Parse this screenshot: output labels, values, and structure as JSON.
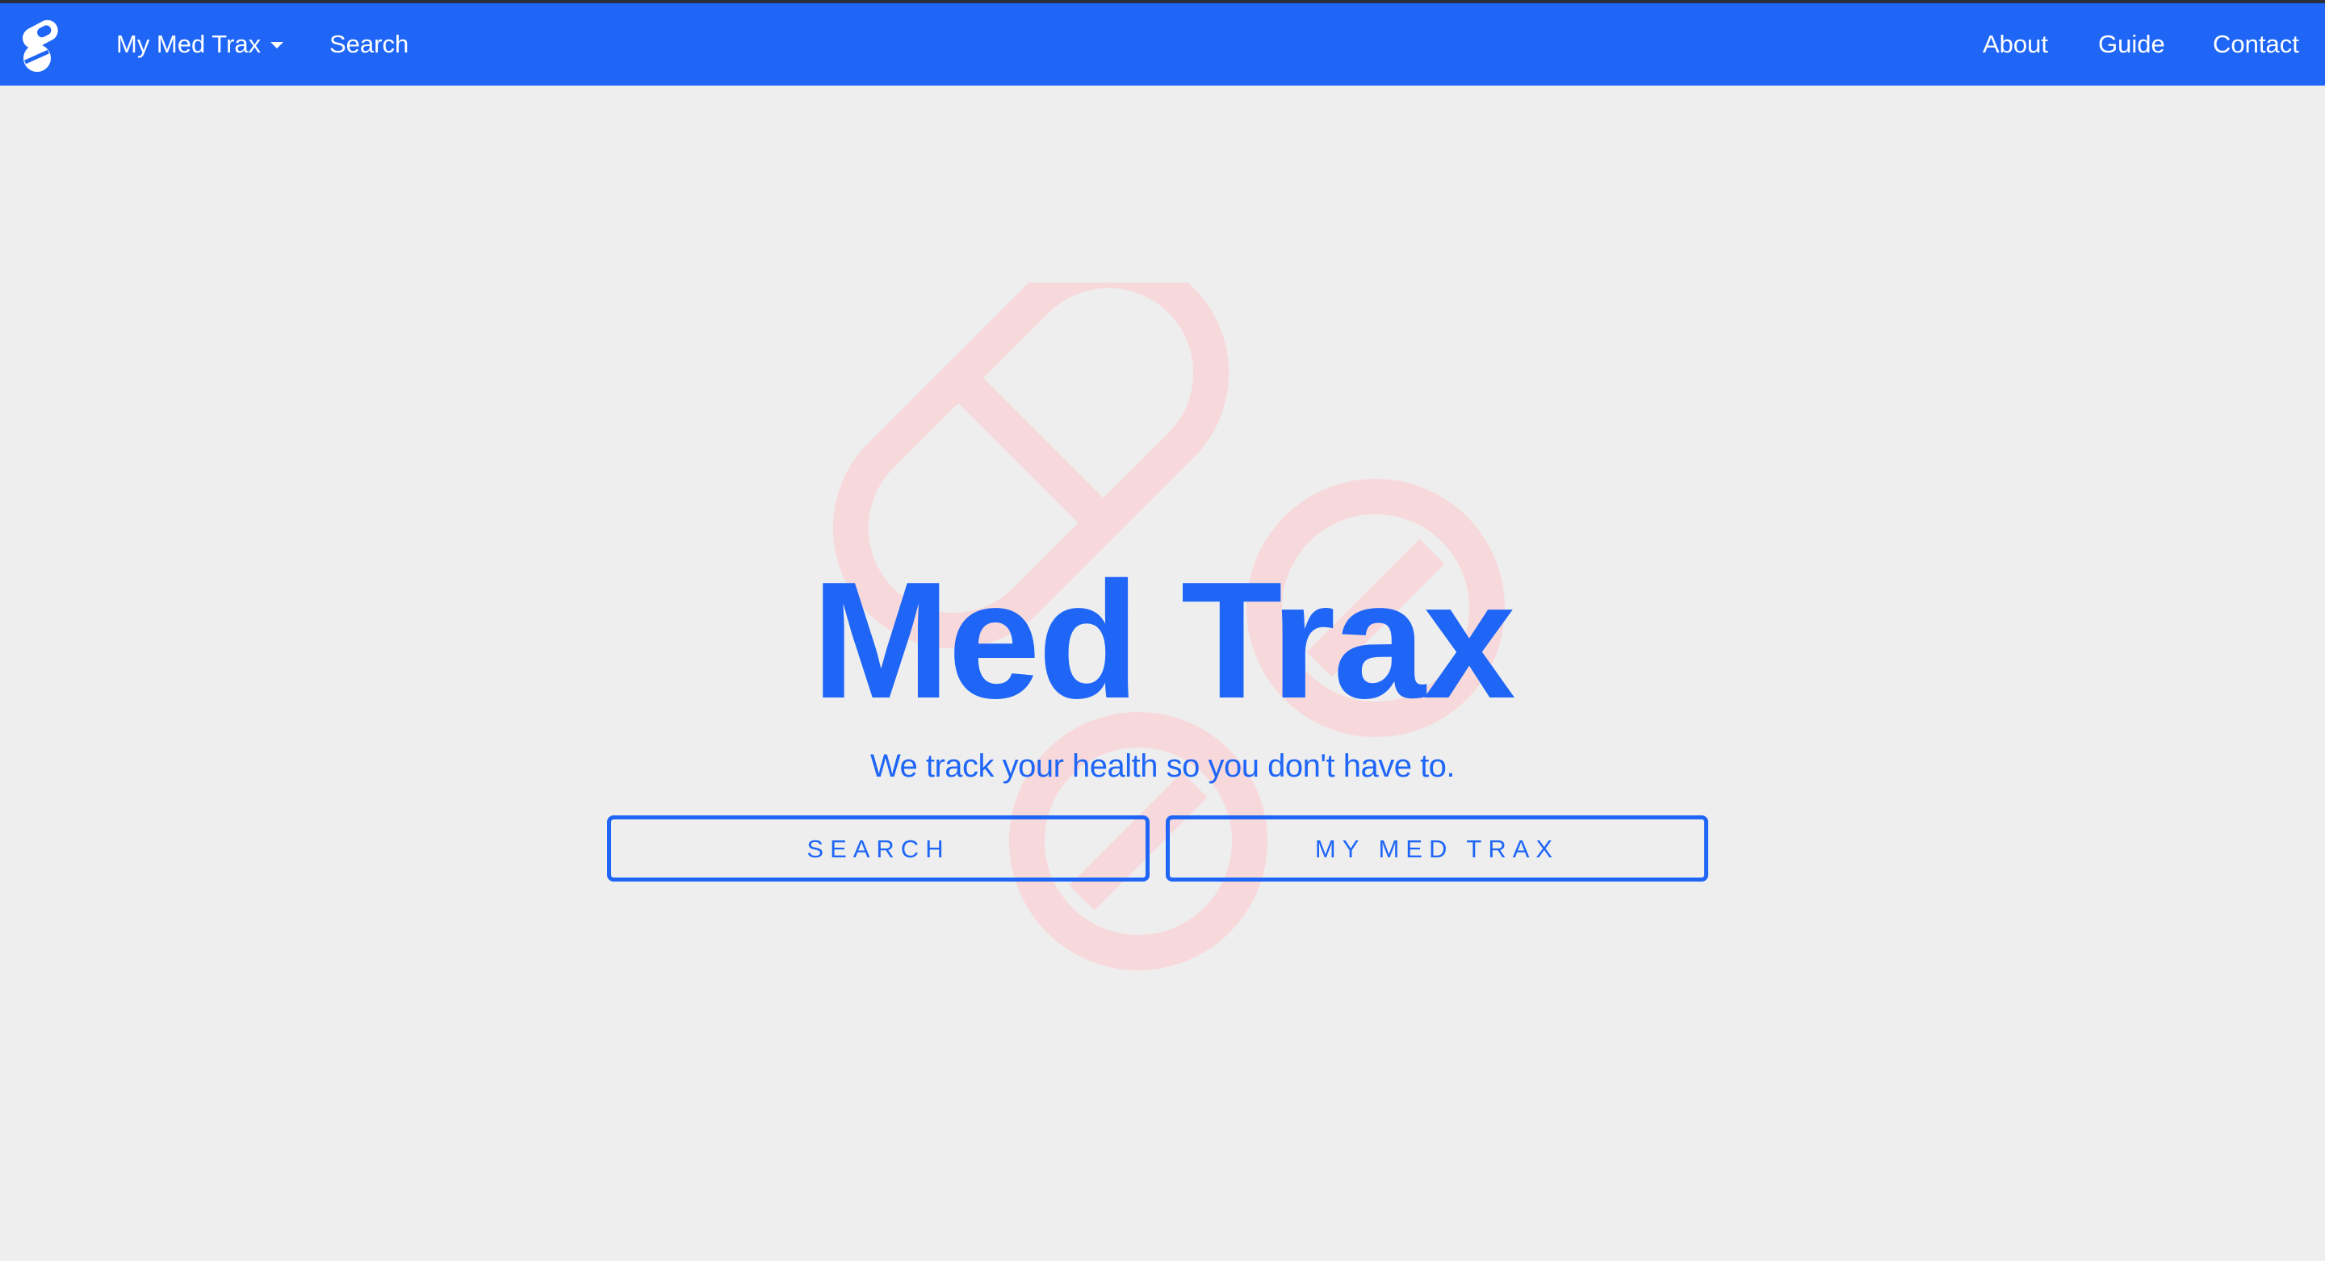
{
  "navbar": {
    "brand_icon": "pill-logo-icon",
    "my_med_trax_label": "My Med Trax",
    "search_label": "Search",
    "about_label": "About",
    "guide_label": "Guide",
    "contact_label": "Contact"
  },
  "hero": {
    "background_icon": "pills-watermark-icon",
    "title": "Med Trax",
    "tagline": "We track your health so you don't have to.",
    "search_button": "SEARCH",
    "my_med_trax_button": "MY MED TRAX"
  },
  "colors": {
    "primary": "#1f66f7",
    "background": "#eeeeef",
    "watermark": "#f8d9db"
  }
}
